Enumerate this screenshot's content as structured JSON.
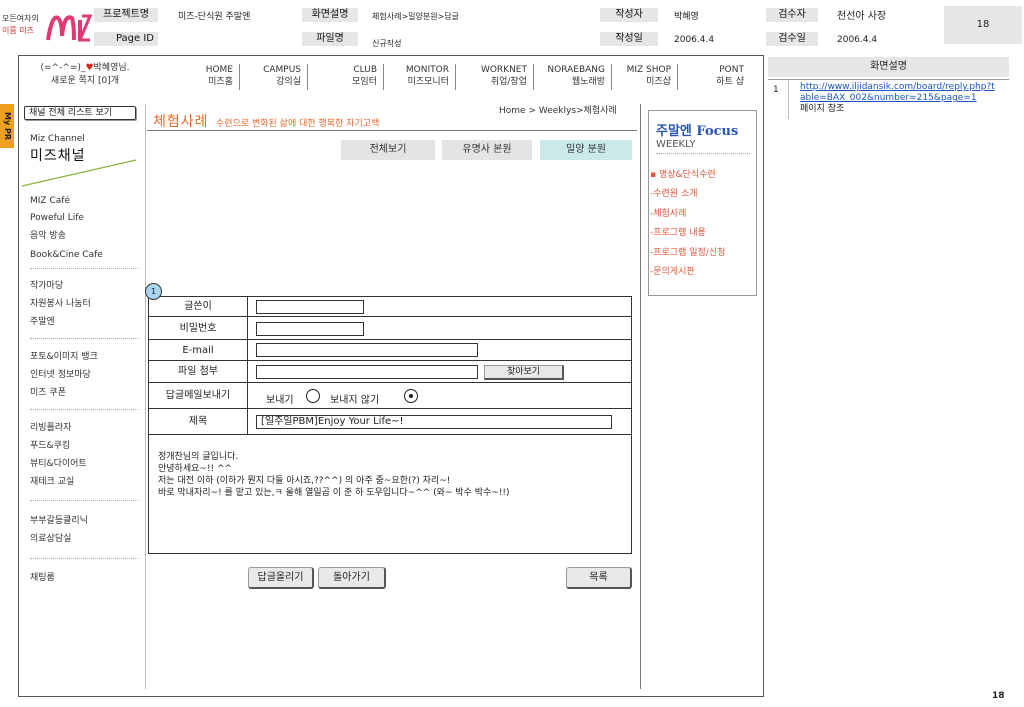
{
  "logo": {
    "line1": "모든여자의",
    "line2": "이름 미즈",
    "mark": "MIZ"
  },
  "header": {
    "project_label": "프로젝트명",
    "project_value": "미즈-단식원 주말엔",
    "pageid_label": "Page ID",
    "screen_label": "화면설명",
    "screen_value": "체험사례>밀양분원>답글",
    "file_label": "파일명",
    "file_value": "신규작성",
    "author_label": "작성자",
    "author_value": "박혜영",
    "date_label": "작성일",
    "date_value": "2006.4.4",
    "reviewer_label": "검수자",
    "reviewer_value": "천선아 사장",
    "review_date_label": "검수일",
    "review_date_value": "2006.4.4",
    "page_number": "18"
  },
  "user": {
    "line1": "(=^-^=)_",
    "heart": "♥",
    "name": "박혜영님.",
    "line2": "새로운 쪽지 [0]개"
  },
  "nav": [
    {
      "en": "HOME",
      "ko": "미즈홈"
    },
    {
      "en": "CAMPUS",
      "ko": "강의실"
    },
    {
      "en": "CLUB",
      "ko": "모임터"
    },
    {
      "en": "MONITOR",
      "ko": "미즈모니터"
    },
    {
      "en": "WORKNET",
      "ko": "취업/창업"
    },
    {
      "en": "NORAEBANG",
      "ko": "웹노래방"
    },
    {
      "en": "MIZ SHOP",
      "ko": "미즈샵"
    },
    {
      "en": "PONT",
      "ko": "하트 샵"
    }
  ],
  "mypr": "My PR",
  "sidebar": {
    "channel_button": "채널 전체 리스트 보기",
    "subtitle": "Miz Channel",
    "title": "미즈채널",
    "groups": [
      [
        "MIZ Café",
        "Poweful Life",
        "음악 방송",
        "Book&Cine Cafe"
      ],
      [
        "작가마당",
        "자원봉사 나눔터",
        "주말엔"
      ],
      [
        "포토&이미지 뱅크",
        "인터넷 정보마당",
        "미즈 쿠폰"
      ],
      [
        "리빙플라자",
        "푸드&쿠킹",
        "뷰티&다이어트",
        "재테크 교실"
      ],
      [
        "부부갈등클리닉",
        "의료상담실"
      ],
      [
        "채팅룸"
      ]
    ]
  },
  "content": {
    "title": "체험사례",
    "subtitle": "수련으로 변화된 삶에 대한 행복한 자기고백",
    "breadcrumb": "Home > Weeklys>체험사례",
    "tabs": [
      "전체보기",
      "유명사 본원",
      "밀양 분원"
    ]
  },
  "focus": {
    "title_ko": "주말엔",
    "title_en": "Focus",
    "weekly": "WEEKLY",
    "items": [
      "▪ 명상&단식수련",
      "-수련원 소개",
      "-체험사례",
      "-프로그램 내용",
      "-프로그램 일정/신청",
      "-문의게시판"
    ]
  },
  "form": {
    "annotation": "1",
    "author_label": "글쓴이",
    "author_value": "",
    "password_label": "비밀번호",
    "password_value": "",
    "email_label": "E-mail",
    "email_value": "",
    "file_label": "파일 첨부",
    "file_value": "",
    "find_button": "찾아보기",
    "reply_mail_label": "답글메일보내기",
    "send_label": "보내기",
    "nosend_label": "보내지 않기",
    "subject_label": "제목",
    "subject_value": "[일주일PBM]Enjoy Your Life~!",
    "body": [
      "정개찬님의 글입니다.",
      "안녕하세요~!! ^^",
      "저는 대전 이하 (이하가 뭔지 다들 아시죠,??^^) 의 아주 중~요한(?) 자리~!",
      "바로 막내자리~! 를 맡고 있는,ㅋ 올해 열일곱 이 준 하 도우입니다~^^ (와~ 박수 박수~!!)"
    ]
  },
  "buttons": {
    "submit": "답글올리기",
    "back": "돌아가기",
    "list": "목록"
  },
  "description": {
    "header": "화면설명",
    "num": "1",
    "url": "http://www.iljidansik.com/board/reply.php?table=BAX_002&number=215&page=1",
    "note": "페이지 참조"
  },
  "footer_page": "18"
}
